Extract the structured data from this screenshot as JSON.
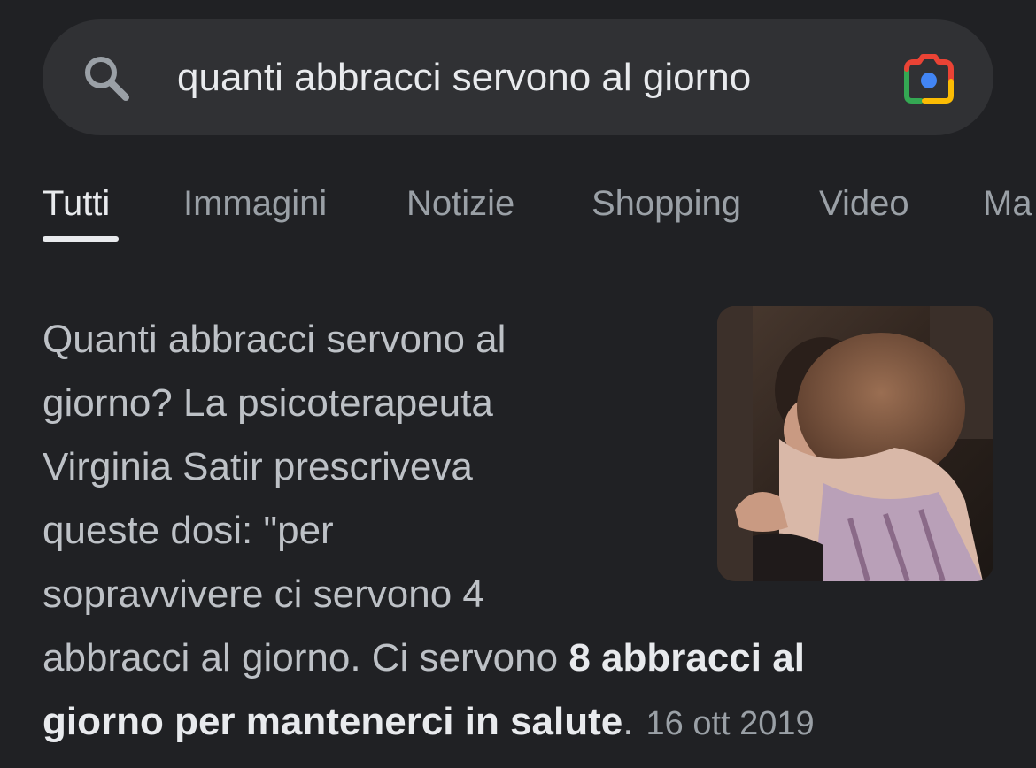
{
  "search": {
    "query": "quanti abbracci servono al giorno",
    "left_icon": "search-icon",
    "right_icon": "google-lens-camera-icon"
  },
  "tabs": [
    {
      "label": "Tutti",
      "active": true
    },
    {
      "label": "Immagini",
      "active": false
    },
    {
      "label": "Notizie",
      "active": false
    },
    {
      "label": "Shopping",
      "active": false
    },
    {
      "label": "Video",
      "active": false
    },
    {
      "label": "Ma",
      "active": false
    }
  ],
  "result": {
    "lines": [
      "Quanti abbracci servono al",
      "giorno? La psicoterapeuta",
      "Virginia Satir prescriveva",
      "queste dosi: \"per",
      "sopravvivere ci servono 4"
    ],
    "line6_normal": "abbracci al giorno. Ci servono ",
    "line6_bold": "8 abbracci al",
    "line7_bold": "giorno per mantenerci in salute",
    "line7_period": ".",
    "date": "16 ott 2019",
    "thumbnail_description": "photo of two people hugging"
  },
  "colors": {
    "background": "#202124",
    "search_bar": "#303134",
    "text_primary": "#e8eaed",
    "text_secondary": "#bdc1c6",
    "text_muted": "#9aa0a6"
  }
}
